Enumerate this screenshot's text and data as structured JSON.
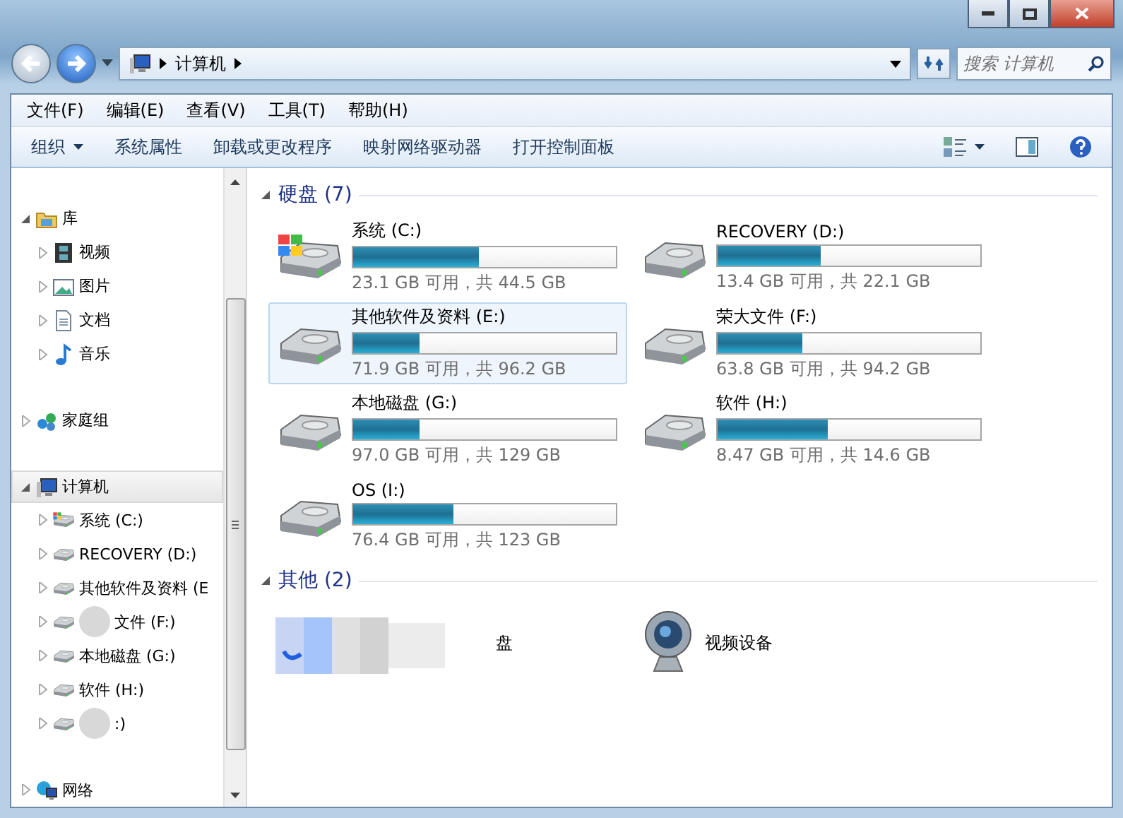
{
  "window": {
    "address": [
      "计算机"
    ],
    "search_placeholder": "搜索 计算机"
  },
  "menu": [
    "文件(F)",
    "编辑(E)",
    "查看(V)",
    "工具(T)",
    "帮助(H)"
  ],
  "toolbar": [
    {
      "label": "组织",
      "dropdown": true
    },
    {
      "label": "系统属性",
      "dropdown": false
    },
    {
      "label": "卸载或更改程序",
      "dropdown": false
    },
    {
      "label": "映射网络驱动器",
      "dropdown": false
    },
    {
      "label": "打开控制面板",
      "dropdown": false
    }
  ],
  "sidebar": [
    {
      "label": "库",
      "kind": "library",
      "expanded": true,
      "selected": false,
      "children": [
        {
          "label": "视频",
          "kind": "video",
          "expanded": false,
          "selected": false
        },
        {
          "label": "图片",
          "kind": "pictures",
          "expanded": false,
          "selected": false
        },
        {
          "label": "文档",
          "kind": "documents",
          "expanded": false,
          "selected": false
        },
        {
          "label": "音乐",
          "kind": "music",
          "expanded": false,
          "selected": false
        }
      ]
    },
    {
      "label": "家庭组",
      "kind": "homegroup",
      "expanded": false,
      "selected": false
    },
    {
      "label": "计算机",
      "kind": "computer",
      "expanded": true,
      "selected": true,
      "children": [
        {
          "label": "系统 (C:)",
          "kind": "system-drive",
          "expanded": false,
          "selected": false
        },
        {
          "label": "RECOVERY (D:)",
          "kind": "drive",
          "expanded": false,
          "selected": false
        },
        {
          "label": "其他软件及资料 (E",
          "kind": "drive",
          "expanded": false,
          "selected": false
        },
        {
          "label": "文件 (F:)",
          "kind": "drive",
          "expanded": false,
          "selected": false,
          "blurred": true
        },
        {
          "label": "本地磁盘 (G:)",
          "kind": "drive",
          "expanded": false,
          "selected": false
        },
        {
          "label": "软件 (H:)",
          "kind": "drive",
          "expanded": false,
          "selected": false
        },
        {
          "label": ":)",
          "kind": "drive",
          "expanded": false,
          "selected": false,
          "blurred": true
        }
      ]
    },
    {
      "label": "网络",
      "kind": "network",
      "expanded": false,
      "selected": false
    }
  ],
  "sections": [
    {
      "title": "硬盘 (7)",
      "expanded": true,
      "items": [
        {
          "kind": "system-drive",
          "name": "系统 (C:)",
          "level": 0.48,
          "info": "23.1 GB 可用，共 44.5 GB",
          "selected": false
        },
        {
          "kind": "drive",
          "name": "RECOVERY (D:)",
          "level": 0.39,
          "info": "13.4 GB 可用，共 22.1 GB",
          "selected": false
        },
        {
          "kind": "drive",
          "name": "其他软件及资料 (E:)",
          "level": 0.25,
          "info": "71.9 GB 可用，共 96.2 GB",
          "selected": true
        },
        {
          "kind": "drive",
          "name": "荣大文件 (F:)",
          "level": 0.32,
          "info": "63.8 GB 可用，共 94.2 GB",
          "selected": false
        },
        {
          "kind": "drive",
          "name": "本地磁盘 (G:)",
          "level": 0.25,
          "info": "97.0 GB 可用，共 129 GB",
          "selected": false
        },
        {
          "kind": "drive",
          "name": "软件 (H:)",
          "level": 0.42,
          "info": "8.47 GB 可用，共 14.6 GB",
          "selected": false
        },
        {
          "kind": "drive",
          "name": "OS (I:)",
          "level": 0.38,
          "info": "76.4 GB 可用，共 123 GB",
          "selected": false
        }
      ]
    },
    {
      "title": "其他 (2)",
      "expanded": true,
      "items": [
        {
          "kind": "blurred",
          "name": "盘",
          "selected": false
        },
        {
          "kind": "webcam",
          "name": "视频设备",
          "selected": false
        }
      ]
    }
  ]
}
